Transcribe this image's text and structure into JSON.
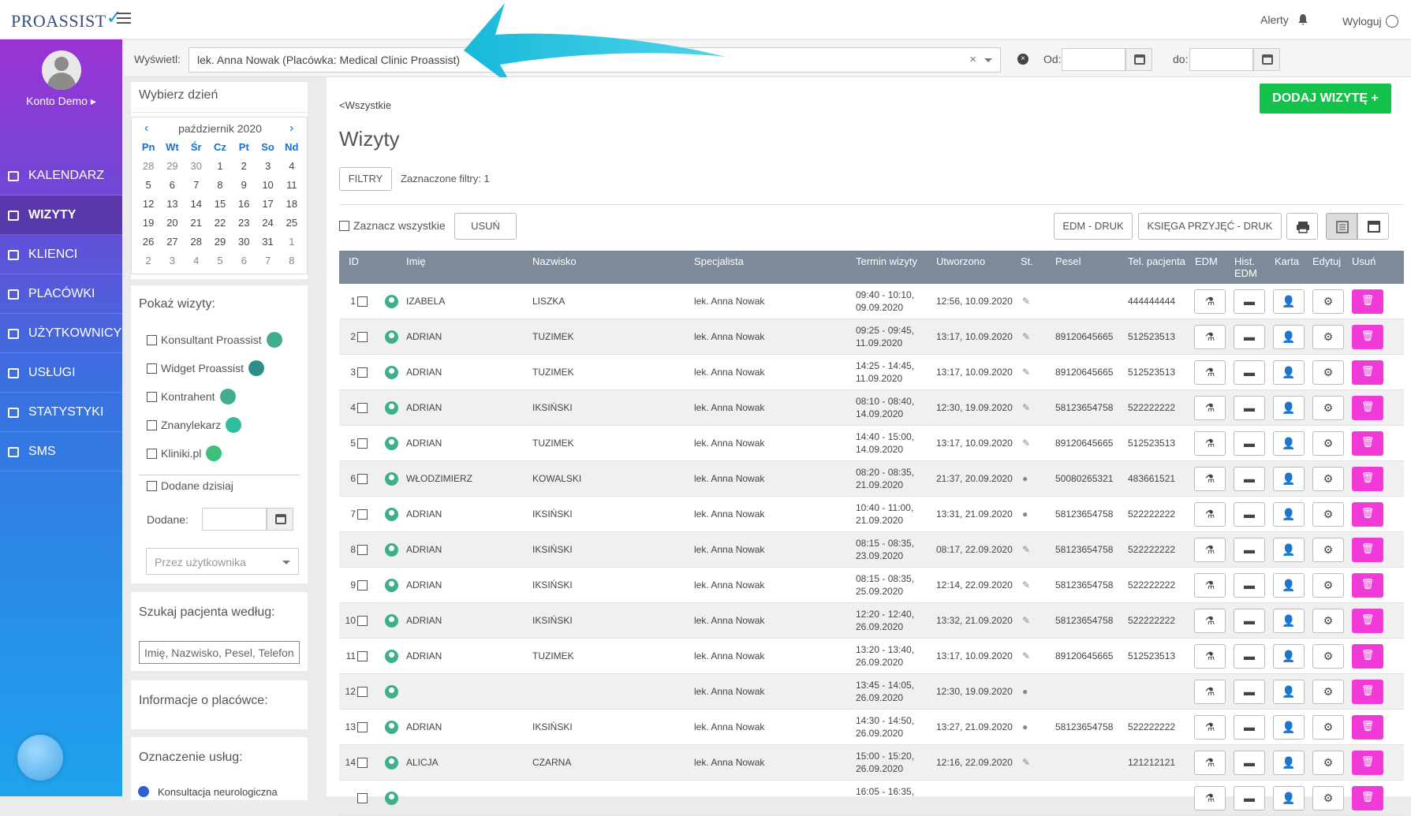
{
  "header": {
    "logo_text": "PROASSIST",
    "alerts_label": "Alerty",
    "logout_label": "Wyloguj"
  },
  "sidebar": {
    "account_label": "Konto Demo",
    "items": [
      {
        "label": "KALENDARZ",
        "icon": "calendar-icon"
      },
      {
        "label": "WIZYTY",
        "icon": "list-icon",
        "active": true
      },
      {
        "label": "KLIENCI",
        "icon": "users-icon"
      },
      {
        "label": "PLACÓWKI",
        "icon": "user-plus-icon"
      },
      {
        "label": "UŻYTKOWNICY",
        "icon": "user-circle-icon"
      },
      {
        "label": "USŁUGI",
        "icon": "grid-icon"
      },
      {
        "label": "STATYSTYKI",
        "icon": "bar-chart-icon"
      },
      {
        "label": "SMS",
        "icon": "phone-icon"
      }
    ]
  },
  "filterbar": {
    "label": "Wyświetl:",
    "selected": "lek. Anna Nowak (Placówka: Medical Clinic Proassist)",
    "from_label": "Od:",
    "to_label": "do:",
    "from_value": "",
    "to_value": ""
  },
  "calendar": {
    "title": "Wybierz dzień",
    "month": "październik 2020",
    "prev": "‹",
    "next": "›",
    "weekdays": [
      "Pn",
      "Wt",
      "Śr",
      "Cz",
      "Pt",
      "So",
      "Nd"
    ],
    "days": [
      "28",
      "29",
      "30",
      "1",
      "2",
      "3",
      "4",
      "5",
      "6",
      "7",
      "8",
      "9",
      "10",
      "11",
      "12",
      "13",
      "14",
      "15",
      "16",
      "17",
      "18",
      "19",
      "20",
      "21",
      "22",
      "23",
      "24",
      "25",
      "26",
      "27",
      "28",
      "29",
      "30",
      "31",
      "1",
      "2",
      "3",
      "4",
      "5",
      "6",
      "7",
      "8"
    ]
  },
  "show": {
    "title": "Pokaż wizyty:",
    "sources": [
      {
        "label": "Konsultant Proassist",
        "icon": "proassist-icon",
        "color": "#3fae8f"
      },
      {
        "label": "Widget Proassist",
        "icon": "widget-icon",
        "color": "#2e8f8a"
      },
      {
        "label": "Kontrahent",
        "icon": "contractor-icon",
        "color": "#3fae8f"
      },
      {
        "label": "Znanylekarz",
        "icon": "znanylekarz-icon",
        "color": "#2ebfa0"
      },
      {
        "label": "Kliniki.pl",
        "icon": "kliniki-icon",
        "color": "#3fc07a"
      }
    ],
    "added_today": "Dodane dzisiaj",
    "added_label": "Dodane:",
    "added_value": "",
    "by_user_placeholder": "Przez użytkownika"
  },
  "search": {
    "title": "Szukaj pacjenta według:",
    "placeholder": "Imię, Nazwisko, Pesel, Telefon"
  },
  "info": {
    "title": "Informacje o placówce:"
  },
  "services": {
    "title": "Oznaczenie usług:",
    "first": "Konsultacja neurologiczna"
  },
  "main": {
    "back_link": "<Wszystkie",
    "title": "Wizyty",
    "add_button": "DODAJ WIZYTĘ +",
    "filters_button": "FILTRY",
    "filters_count": "Zaznaczone filtry: 1",
    "select_all": "Zaznacz wszystkie",
    "delete_button": "USUŃ",
    "edm_print": "EDM - DRUK",
    "book_print": "KSIĘGA PRZYJĘĆ - DRUK"
  },
  "table": {
    "columns": [
      "ID",
      "Imię",
      "Nazwisko",
      "Specjalista",
      "Termin wizyty",
      "Utworzono",
      "St.",
      "Pesel",
      "Tel. pacjenta",
      "EDM",
      "Hist. EDM",
      "Karta",
      "Edytuj",
      "Usuń"
    ],
    "rows": [
      {
        "id": "1",
        "first": "IZABELA",
        "last": "LISZKA",
        "spec": "lek. Anna Nowak",
        "term1": "09:40 - 10:10,",
        "term2": "09.09.2020",
        "created": "12:56, 10.09.2020",
        "st": "edit",
        "pesel": "",
        "tel": "444444444"
      },
      {
        "id": "2",
        "first": "ADRIAN",
        "last": "TUZIMEK",
        "spec": "lek. Anna Nowak",
        "term1": "09:25 - 09:45,",
        "term2": "11.09.2020",
        "created": "13:17, 10.09.2020",
        "st": "edit",
        "pesel": "89120645665",
        "tel": "512523513"
      },
      {
        "id": "3",
        "first": "ADRIAN",
        "last": "TUZIMEK",
        "spec": "lek. Anna Nowak",
        "term1": "14:25 - 14:45,",
        "term2": "11.09.2020",
        "created": "13:17, 10.09.2020",
        "st": "edit",
        "pesel": "89120645665",
        "tel": "512523513"
      },
      {
        "id": "4",
        "first": "ADRIAN",
        "last": "IKSIŃSKI",
        "spec": "lek. Anna Nowak",
        "term1": "08:10 - 08:40,",
        "term2": "14.09.2020",
        "created": "12:30, 19.09.2020",
        "st": "edit",
        "pesel": "58123654758",
        "tel": "522222222"
      },
      {
        "id": "5",
        "first": "ADRIAN",
        "last": "TUZIMEK",
        "spec": "lek. Anna Nowak",
        "term1": "14:40 - 15:00,",
        "term2": "14.09.2020",
        "created": "13:17, 10.09.2020",
        "st": "edit",
        "pesel": "89120645665",
        "tel": "512523513"
      },
      {
        "id": "6",
        "first": "WŁODZIMIERZ",
        "last": "KOWALSKI",
        "spec": "lek. Anna Nowak",
        "term1": "08:20 - 08:35,",
        "term2": "21.09.2020",
        "created": "21:37, 20.09.2020",
        "st": "person",
        "pesel": "50080265321",
        "tel": "483661521"
      },
      {
        "id": "7",
        "first": "ADRIAN",
        "last": "IKSIŃSKI",
        "spec": "lek. Anna Nowak",
        "term1": "10:40 - 11:00,",
        "term2": "21.09.2020",
        "created": "13:31, 21.09.2020",
        "st": "person",
        "pesel": "58123654758",
        "tel": "522222222"
      },
      {
        "id": "8",
        "first": "ADRIAN",
        "last": "IKSIŃSKI",
        "spec": "lek. Anna Nowak",
        "term1": "08:15 - 08:35,",
        "term2": "23.09.2020",
        "created": "08:17, 22.09.2020",
        "st": "edit",
        "pesel": "58123654758",
        "tel": "522222222"
      },
      {
        "id": "9",
        "first": "ADRIAN",
        "last": "IKSIŃSKI",
        "spec": "lek. Anna Nowak",
        "term1": "08:15 - 08:35,",
        "term2": "25.09.2020",
        "created": "12:14, 22.09.2020",
        "st": "edit",
        "pesel": "58123654758",
        "tel": "522222222"
      },
      {
        "id": "10",
        "first": "ADRIAN",
        "last": "IKSIŃSKI",
        "spec": "lek. Anna Nowak",
        "term1": "12:20 - 12:40,",
        "term2": "26.09.2020",
        "created": "13:32, 21.09.2020",
        "st": "edit",
        "pesel": "58123654758",
        "tel": "522222222"
      },
      {
        "id": "11",
        "first": "ADRIAN",
        "last": "TUZIMEK",
        "spec": "lek. Anna Nowak",
        "term1": "13:20 - 13:40,",
        "term2": "26.09.2020",
        "created": "13:17, 10.09.2020",
        "st": "edit",
        "pesel": "89120645665",
        "tel": "512523513"
      },
      {
        "id": "12",
        "first": "",
        "last": "",
        "spec": "lek. Anna Nowak",
        "term1": "13:45 - 14:05,",
        "term2": "26.09.2020",
        "created": "12:30, 19.09.2020",
        "st": "person",
        "pesel": "",
        "tel": ""
      },
      {
        "id": "13",
        "first": "ADRIAN",
        "last": "IKSIŃSKI",
        "spec": "lek. Anna Nowak",
        "term1": "14:30 - 14:50,",
        "term2": "26.09.2020",
        "created": "13:27, 21.09.2020",
        "st": "person",
        "pesel": "58123654758",
        "tel": "522222222"
      },
      {
        "id": "14",
        "first": "ALICJA",
        "last": "CZARNA",
        "spec": "lek. Anna Nowak",
        "term1": "15:00 - 15:20,",
        "term2": "26.09.2020",
        "created": "12:16, 22.09.2020",
        "st": "edit",
        "pesel": "",
        "tel": "121212121"
      },
      {
        "id": "",
        "first": "",
        "last": "",
        "spec": "",
        "term1": "16:05 - 16:35,",
        "term2": "",
        "created": "",
        "st": "",
        "pesel": "",
        "tel": ""
      }
    ]
  }
}
